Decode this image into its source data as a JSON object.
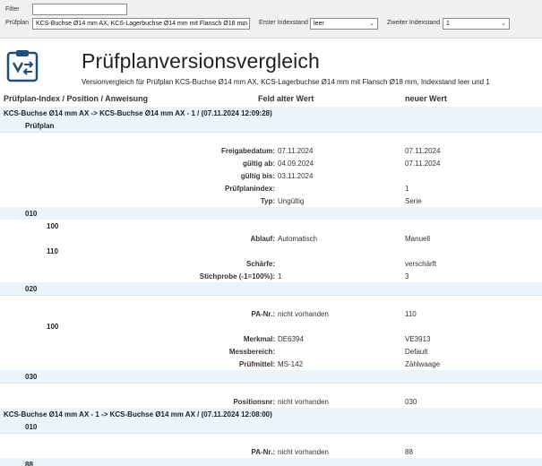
{
  "filter": {
    "label": "Filter",
    "value": "",
    "pruefplan_label": "Prüfplan",
    "pruefplan_value": "KCS-Buchse Ø14 mm AX, KCS-Lagerbuchse Ø14 mm mit Flansch Ø18 mm",
    "erster_label": "Erster Indexstand",
    "erster_value": "leer",
    "zweiter_label": "Zweiter Indexstand",
    "zweiter_value": "1"
  },
  "header": {
    "title": "Prüfplanversionsvergleich",
    "subtitle": "Versionvergleich für Prüfplan KCS-Buchse Ø14 mm AX, KCS-Lagerbuchse Ø14 mm mit Flansch Ø18 mm, Indexstand leer und 1"
  },
  "columns": {
    "index": "Prüfplan-Index / Position / Anweisung",
    "old": "Feld alter Wert",
    "new": "neuer Wert"
  },
  "rows": [
    {
      "type": "group",
      "text": "KCS-Buchse Ø14 mm AX   ->   KCS-Buchse Ø14 mm AX - 1   / (07.11.2024 12:09:28)"
    },
    {
      "type": "section",
      "text": "Prüfplan",
      "indent": 1
    },
    {
      "type": "blank"
    },
    {
      "type": "field",
      "field": "Freigabedatum:",
      "old": "07.11.2024",
      "new": "07.11.2024"
    },
    {
      "type": "field",
      "field": "gültig ab:",
      "old": "04.09.2024",
      "new": "07.11.2024"
    },
    {
      "type": "field",
      "field": "gültig bis:",
      "old": "03.11.2024",
      "new": ""
    },
    {
      "type": "field",
      "field": "Prüfplanindex:",
      "old": "",
      "new": "1"
    },
    {
      "type": "field",
      "field": "Typ:",
      "old": "Ungültig",
      "new": "Serie"
    },
    {
      "type": "section",
      "text": "010",
      "indent": 1
    },
    {
      "type": "label",
      "text": "100",
      "indent": 2
    },
    {
      "type": "field",
      "field": "Ablauf:",
      "old": "Automatisch",
      "new": "Manuell"
    },
    {
      "type": "label",
      "text": "110",
      "indent": 2
    },
    {
      "type": "field",
      "field": "Schärfe:",
      "old": "",
      "new": "verschärft"
    },
    {
      "type": "field",
      "field": "Stichprobe (-1=100%):",
      "old": "1",
      "new": "3"
    },
    {
      "type": "section",
      "text": "020",
      "indent": 1
    },
    {
      "type": "blank"
    },
    {
      "type": "field",
      "field": "PA-Nr.:",
      "old": "nicht vorhanden",
      "new": "110"
    },
    {
      "type": "label",
      "text": "100",
      "indent": 2
    },
    {
      "type": "field",
      "field": "Merkmal:",
      "old": "DE6394",
      "new": "VE3913"
    },
    {
      "type": "field",
      "field": "Messbereich:",
      "old": "",
      "new": "Default"
    },
    {
      "type": "field",
      "field": "Prüfmittel:",
      "old": "MS-142",
      "new": "Zählwaage"
    },
    {
      "type": "section",
      "text": "030",
      "indent": 1
    },
    {
      "type": "blank"
    },
    {
      "type": "field",
      "field": "Positionsnr:",
      "old": "nicht vorhanden",
      "new": "030"
    },
    {
      "type": "group",
      "text": "KCS-Buchse Ø14 mm AX - 1   ->   KCS-Buchse Ø14 mm AX   / (07.11.2024 12:08:00)"
    },
    {
      "type": "section",
      "text": "010",
      "indent": 1
    },
    {
      "type": "blank"
    },
    {
      "type": "field",
      "field": "PA-Nr.:",
      "old": "nicht vorhanden",
      "new": "88"
    },
    {
      "type": "section",
      "text": "88",
      "indent": 1
    }
  ],
  "colors": {
    "band": "#e9f5fb",
    "logo": "#1f4e79"
  }
}
